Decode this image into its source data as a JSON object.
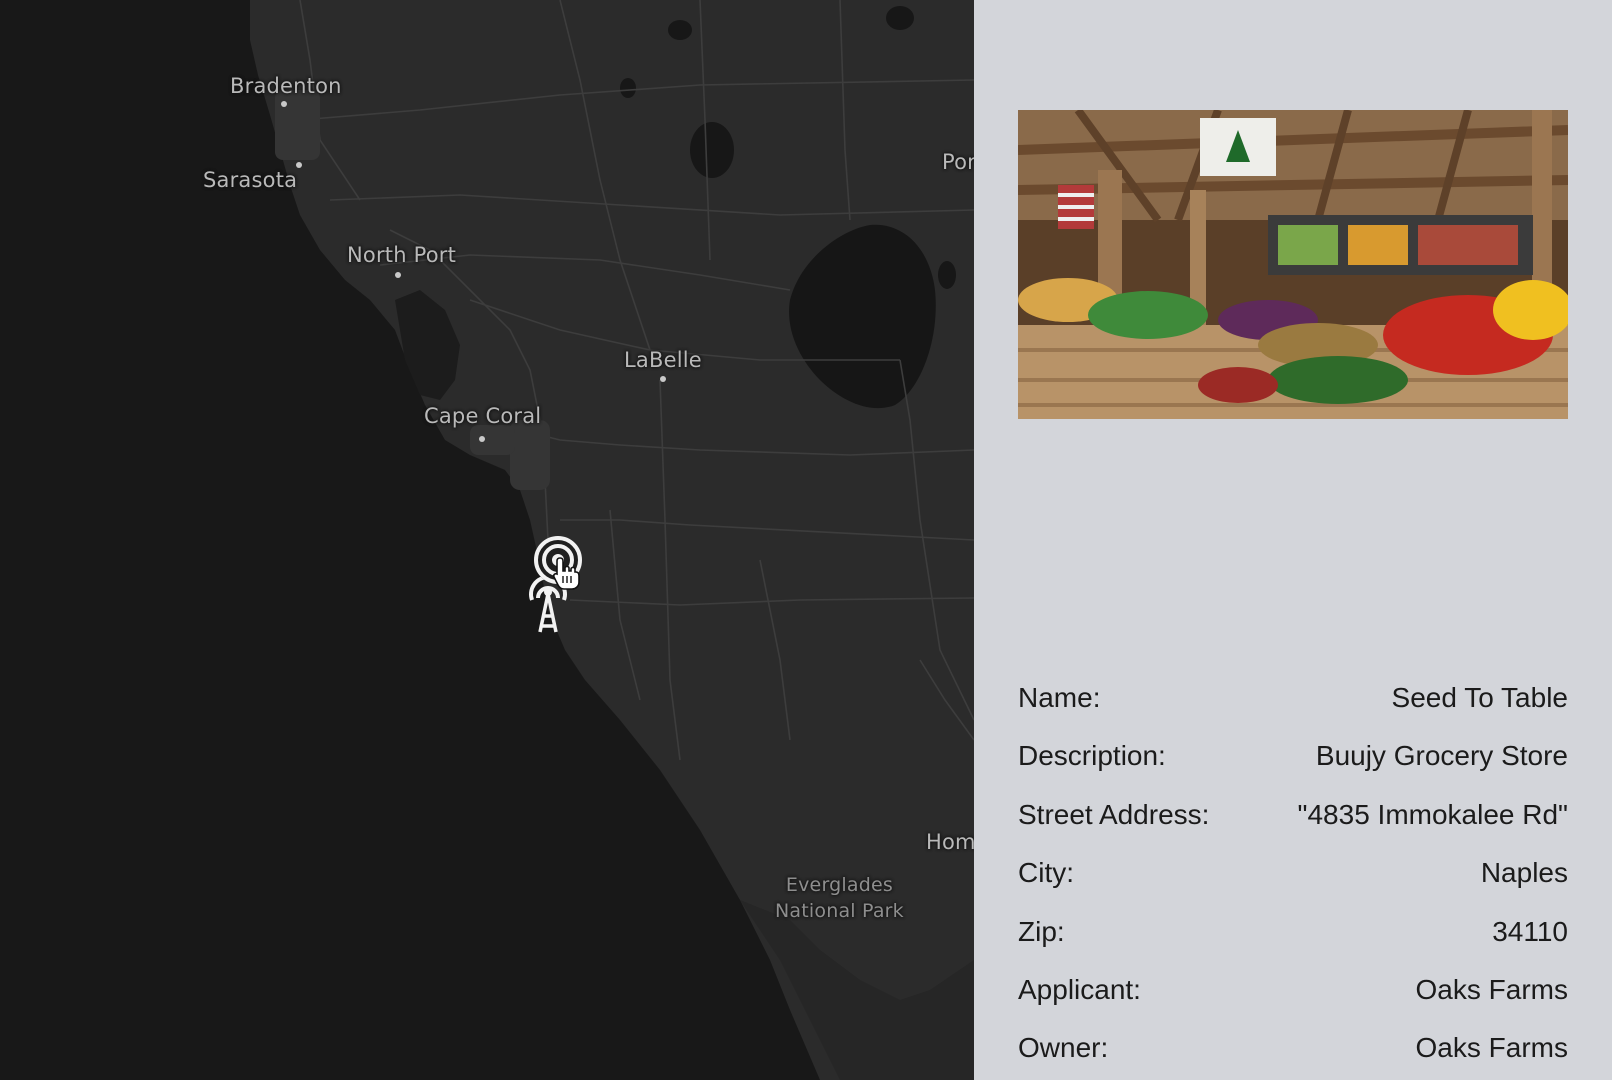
{
  "map": {
    "places": [
      {
        "key": "bradenton",
        "name": "Bradenton"
      },
      {
        "key": "sarasota",
        "name": "Sarasota"
      },
      {
        "key": "north_port",
        "name": "North Port"
      },
      {
        "key": "labelle",
        "name": "LaBelle"
      },
      {
        "key": "cape_coral",
        "name": "Cape Coral"
      },
      {
        "key": "por",
        "name": "Por"
      },
      {
        "key": "hom",
        "name": "Hom"
      }
    ],
    "park": {
      "line1": "Everglades",
      "line2": "National Park"
    },
    "markers": [
      {
        "icon": "radio-tower-icon"
      },
      {
        "icon": "radio-tower-icon"
      }
    ],
    "cursor_icon": "hand-pointer-icon"
  },
  "details": {
    "photo_icon": "produce-market-photo",
    "rows": [
      {
        "label": "Name:",
        "value": "Seed To Table"
      },
      {
        "label": "Description:",
        "value": "Buujy Grocery Store"
      },
      {
        "label": "Street Address:",
        "value": "\"4835 Immokalee Rd\""
      },
      {
        "label": "City:",
        "value": "Naples"
      },
      {
        "label": "Zip:",
        "value": "34110"
      },
      {
        "label": "Applicant:",
        "value": "Oaks Farms"
      },
      {
        "label": "Owner:",
        "value": "Oaks Farms"
      }
    ]
  },
  "colors": {
    "water": "#181818",
    "land": "#2b2b2b",
    "panel": "#d3d5da"
  }
}
